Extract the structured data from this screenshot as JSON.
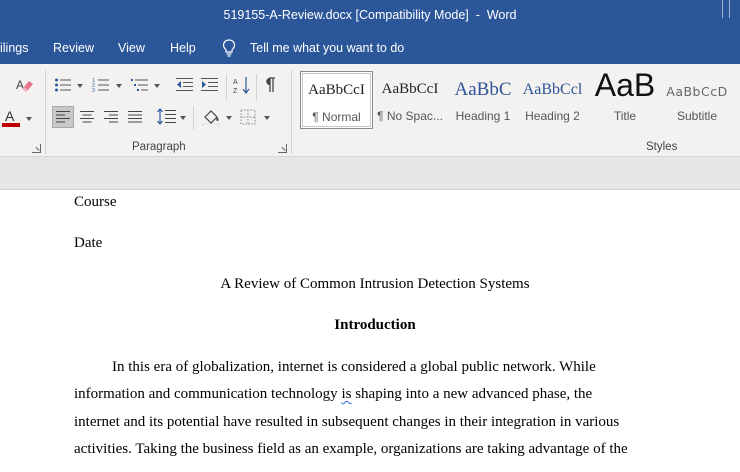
{
  "window": {
    "title": "519155-A-Review.docx [Compatibility Mode]  -  Word"
  },
  "menu": {
    "tabs": [
      "ilings",
      "Review",
      "View",
      "Help"
    ],
    "tell_me": "Tell me what you want to do"
  },
  "ribbon": {
    "paragraph_group": "Paragraph",
    "styles_group": "Styles",
    "styles": [
      {
        "sample": "AaBbCcI",
        "name": "¶ Normal"
      },
      {
        "sample": "AaBbCcI",
        "name": "¶ No Spac..."
      },
      {
        "sample": "AaBbC",
        "name": "Heading 1"
      },
      {
        "sample": "AaBbCcl",
        "name": "Heading 2"
      },
      {
        "sample": "AaB",
        "name": "Title"
      },
      {
        "sample": "AaBbCcD",
        "name": "Subtitle"
      }
    ],
    "accent_color": "#2b579a",
    "font_color": "#c00000"
  },
  "document": {
    "course": "Course",
    "date": "Date",
    "title": "A Review of Common Intrusion Detection Systems",
    "heading": "Introduction",
    "para": {
      "l1": "In this era of globalization, internet is considered a global public network. While",
      "l2a": "information and communication technology ",
      "l2b": "is",
      "l2c": " shaping into a new advanced phase, the",
      "l3": "internet and its potential have resulted in subsequent changes in their integration in various",
      "l4": "activities. Taking the business field as an example, organizations are taking advantage of the"
    }
  }
}
